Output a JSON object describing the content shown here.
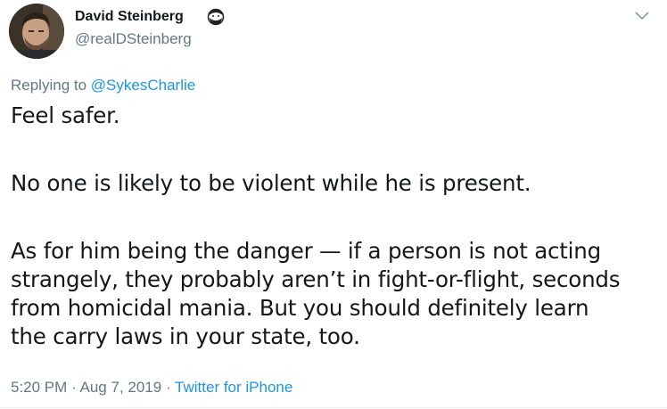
{
  "author": {
    "display_name": "David Steinberg",
    "handle": "@realDSteinberg",
    "badge_icon": "bearded-face-emoji-icon"
  },
  "reply": {
    "prefix": "Replying to",
    "mention": "@SykesCharlie"
  },
  "tweet": {
    "paragraph_1": "Feel safer.",
    "paragraph_2": "No one is likely to be violent while he is present.",
    "paragraph_3_line_1": "As for him being the danger — if a person is not acting",
    "paragraph_3_line_2": "strangely, they probably aren’t in fight-or-flight, seconds",
    "paragraph_3_line_3": "from homicidal mania. But you should definitely learn",
    "paragraph_3_line_4": "the carry laws in your state, too."
  },
  "meta": {
    "time": "5:20 PM",
    "separator_1": "·",
    "date": "Aug 7, 2019",
    "separator_2": "·",
    "source": "Twitter for iPhone"
  },
  "colors": {
    "text": "#14171a",
    "secondary": "#657786",
    "link": "#1b95e0"
  }
}
